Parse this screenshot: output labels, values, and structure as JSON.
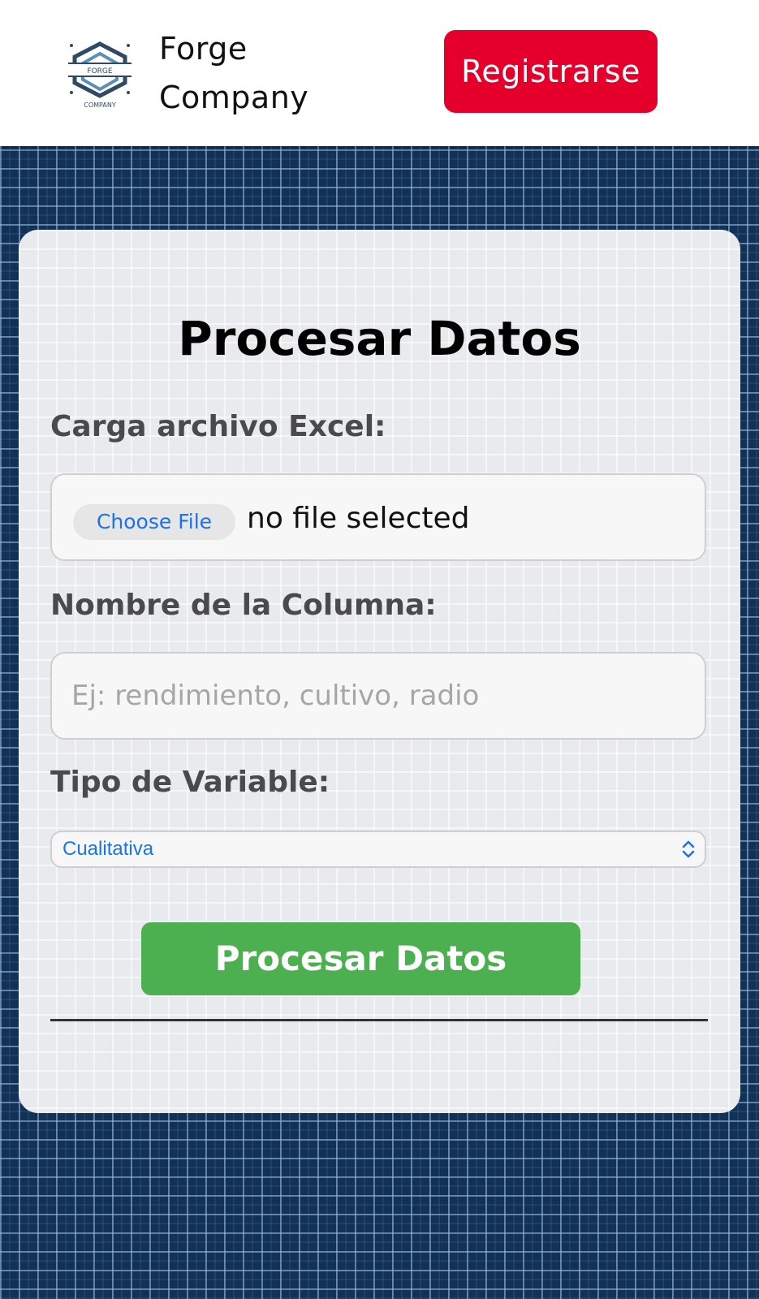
{
  "header": {
    "brand_line1": "Forge",
    "brand_line2": "Company",
    "logo_text_top": "FORGE",
    "logo_text_bottom": "COMPANY",
    "register_label": "Registrarse",
    "register_color": "#e4002b"
  },
  "form": {
    "title": "Procesar Datos",
    "file_label": "Carga archivo Excel:",
    "choose_file_label": "Choose File",
    "file_status": "no file selected",
    "column_label": "Nombre de la Columna:",
    "column_placeholder": "Ej: rendimiento, cultivo, radio",
    "column_value": "",
    "variable_label": "Tipo de Variable:",
    "variable_selected": "Cualitativa",
    "submit_label": "Procesar Datos",
    "submit_color": "#4caf50"
  },
  "icons": {
    "logo": "forge-company-logo",
    "select": "chevron-up-down-icon"
  }
}
